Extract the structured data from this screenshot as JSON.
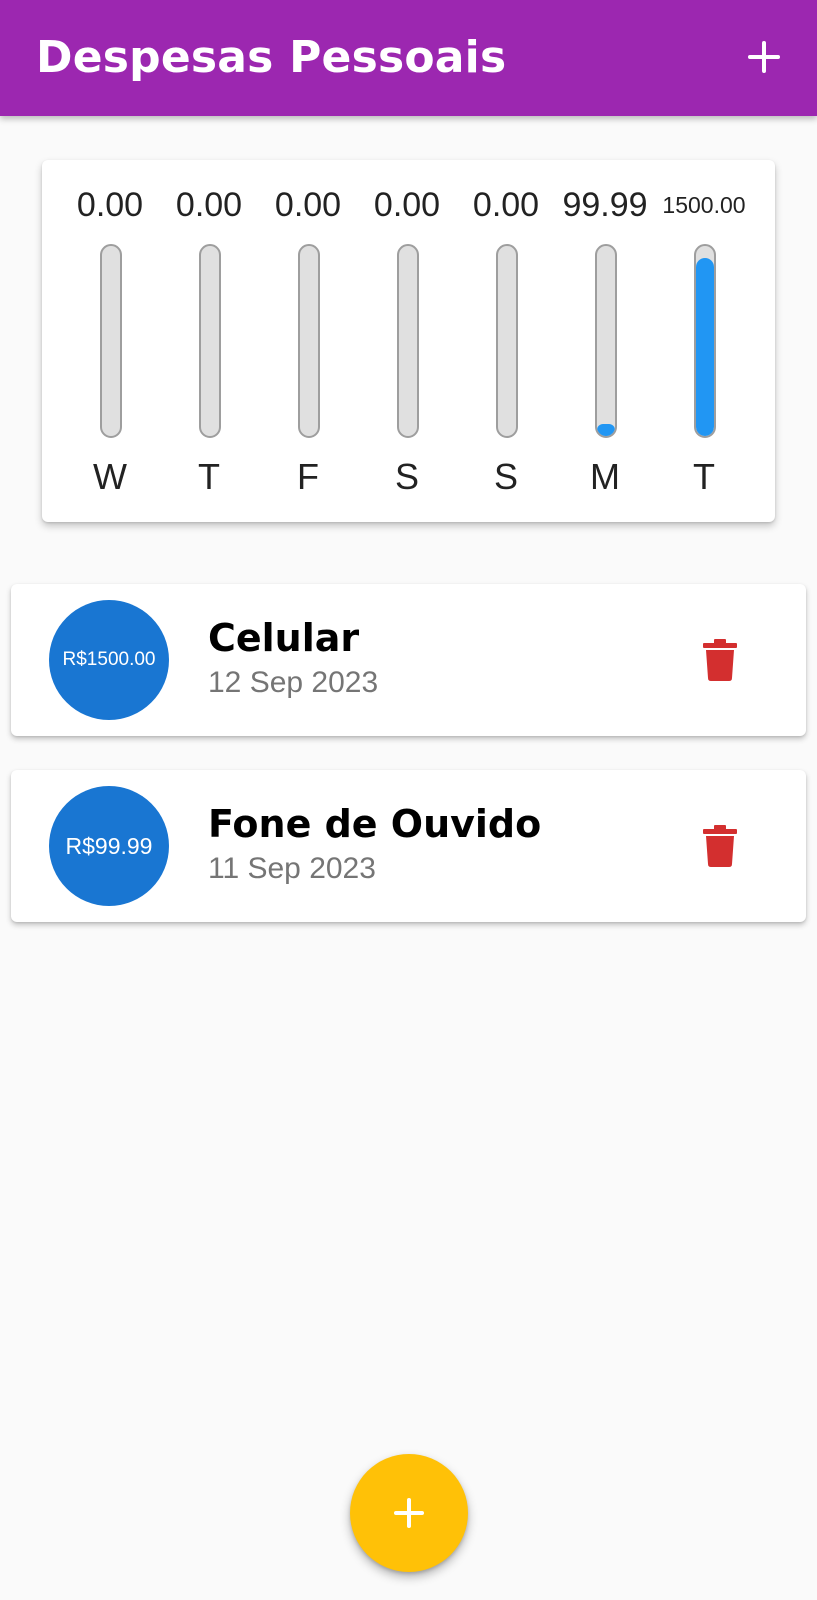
{
  "appbar": {
    "title": "Despesas Pessoais",
    "add_icon": "plus-icon"
  },
  "chart_data": {
    "type": "bar",
    "categories": [
      "W",
      "T",
      "F",
      "S",
      "S",
      "M",
      "T"
    ],
    "value_labels": [
      "0.00",
      "0.00",
      "0.00",
      "0.00",
      "0.00",
      "99.99",
      "1500.00"
    ],
    "values": [
      0,
      0,
      0,
      0,
      0,
      99.99,
      1500.0
    ],
    "fill_fraction": [
      0,
      0,
      0,
      0,
      0,
      0.0625,
      0.9375
    ],
    "bar_color": "#2196f3",
    "track_color": "#e0e0e0"
  },
  "transactions": [
    {
      "amount": "R$1500.00",
      "title": "Celular",
      "date": "12 Sep 2023",
      "delete_icon": "trash-icon"
    },
    {
      "amount": "R$99.99",
      "title": "Fone de Ouvido",
      "date": "11 Sep 2023",
      "delete_icon": "trash-icon"
    }
  ],
  "fab": {
    "icon": "plus-icon"
  },
  "colors": {
    "appbar": "#9c27b0",
    "avatar": "#1976d2",
    "delete": "#d32f2f",
    "fab": "#ffc107"
  }
}
